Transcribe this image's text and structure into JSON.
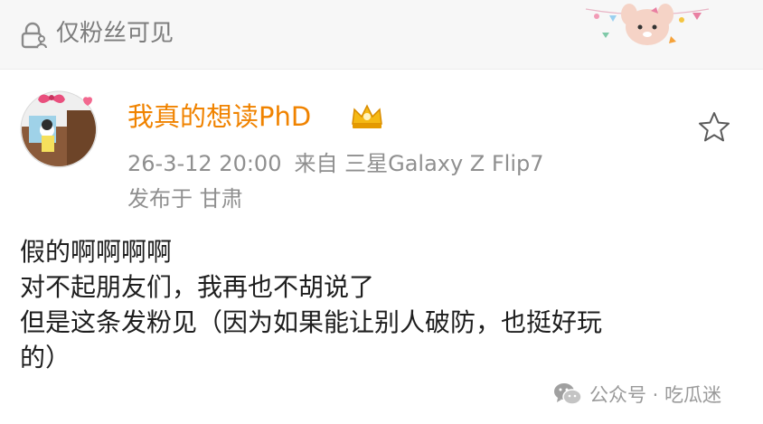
{
  "header": {
    "visibility_icon": "lock-user-icon",
    "visibility_label": "仅粉丝可见",
    "sticker": "cartoon-character-sticker"
  },
  "post": {
    "avatar": "cartoon-avatar",
    "username": "我真的想读PhD",
    "badge": "crown-vip-icon",
    "date": "26-3-12 20:00",
    "source": "来自 三星Galaxy Z Flip7",
    "location": "发布于 甘肃",
    "favorite_icon": "star-icon",
    "content_lines": [
      "假的啊啊啊啊",
      "对不起朋友们，我再也不胡说了",
      "但是这条发粉见（因为如果能让别人破防，也挺好玩",
      "的）"
    ]
  },
  "watermark": {
    "icon": "wechat-icon",
    "text": "公众号 · 吃瓜迷"
  },
  "colors": {
    "username": "#f08300",
    "meta": "#8f8f8f",
    "text": "#1e1e1e",
    "topbar_bg": "#f7f7f7"
  }
}
